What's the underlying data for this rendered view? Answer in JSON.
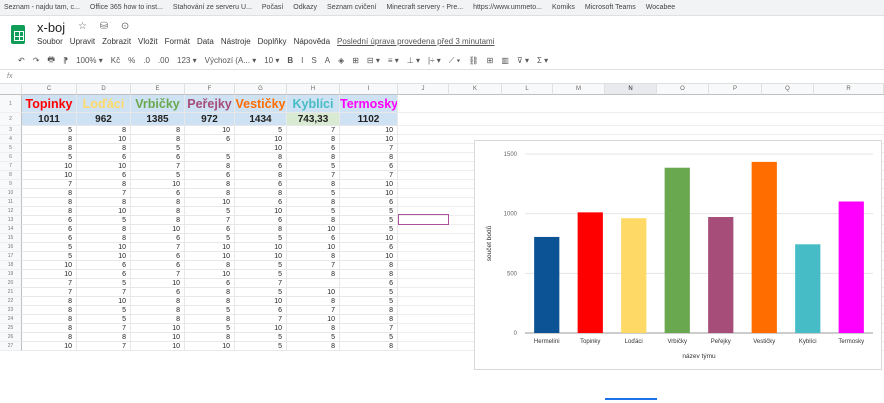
{
  "bookmarks": [
    "Seznam - najdu tam, c...",
    "Office 365 how to inst...",
    "Stahování ze serveru U...",
    "Počasí",
    "Odkazy",
    "Seznam cvičení",
    "Minecraft servery - Pre...",
    "https://www.ummeto...",
    "Komiks",
    "Microsoft Teams",
    "Wocabee"
  ],
  "doc": {
    "title": "x-boj",
    "icons": "☆ ⛁ ⊙",
    "menu": [
      "Soubor",
      "Upravit",
      "Zobrazit",
      "Vložit",
      "Formát",
      "Data",
      "Nástroje",
      "Doplňky",
      "Nápověda"
    ],
    "last_edit": "Poslední úprava provedena před 3 minutami"
  },
  "toolbar": [
    "↶",
    "↷",
    "🖶",
    "⁋",
    "100% ▾",
    "Kč",
    "%",
    ".0",
    ".00",
    "123 ▾",
    "Výchozí (A... ▾",
    "10 ▾",
    "B",
    "I",
    "S",
    "A",
    "◈",
    "⊞",
    "⊟ ▾",
    "≡ ▾",
    "⊥ ▾",
    "|÷ ▾",
    "⟋ ▾",
    "⛓",
    "⊞",
    "▥",
    "⊽ ▾",
    "Σ ▾"
  ],
  "formula_bar": "fx",
  "columns": [
    "C",
    "D",
    "E",
    "F",
    "G",
    "H",
    "I",
    "J",
    "K",
    "L",
    "M",
    "N",
    "O",
    "P",
    "Q",
    "R"
  ],
  "selected_column": "N",
  "teams": [
    {
      "name": "Topinky",
      "color": "#ff0000"
    },
    {
      "name": "Loďáci",
      "color": "#ffd966"
    },
    {
      "name": "Vrbičky",
      "color": "#6aa84f"
    },
    {
      "name": "Peřejky",
      "color": "#a64d79"
    },
    {
      "name": "Vestičky",
      "color": "#ff6d01"
    },
    {
      "name": "Kyblíci",
      "color": "#46bdc6"
    },
    {
      "name": "Termosky",
      "color": "#ff00ff"
    }
  ],
  "totals": [
    "1011",
    "962",
    "1385",
    "972",
    "1434",
    "743,33",
    "1102"
  ],
  "rows": [
    [
      "5",
      "8",
      "8",
      "10",
      "5",
      "7",
      "10"
    ],
    [
      "8",
      "10",
      "8",
      "6",
      "10",
      "8",
      "10"
    ],
    [
      "8",
      "8",
      "5",
      "",
      "10",
      "6",
      "7"
    ],
    [
      "5",
      "6",
      "6",
      "5",
      "8",
      "8",
      "8"
    ],
    [
      "10",
      "10",
      "7",
      "8",
      "6",
      "5",
      "6"
    ],
    [
      "10",
      "6",
      "5",
      "6",
      "8",
      "7",
      "7"
    ],
    [
      "7",
      "8",
      "10",
      "8",
      "6",
      "8",
      "10"
    ],
    [
      "8",
      "7",
      "6",
      "8",
      "8",
      "5",
      "10"
    ],
    [
      "8",
      "8",
      "8",
      "10",
      "6",
      "8",
      "6"
    ],
    [
      "8",
      "10",
      "8",
      "5",
      "10",
      "5",
      "5"
    ],
    [
      "6",
      "5",
      "8",
      "7",
      "6",
      "8",
      "5"
    ],
    [
      "6",
      "8",
      "10",
      "6",
      "8",
      "10",
      "5"
    ],
    [
      "6",
      "8",
      "6",
      "5",
      "5",
      "6",
      "10"
    ],
    [
      "5",
      "10",
      "7",
      "10",
      "10",
      "10",
      "6"
    ],
    [
      "5",
      "10",
      "6",
      "10",
      "10",
      "8",
      "10"
    ],
    [
      "10",
      "6",
      "6",
      "8",
      "5",
      "7",
      "8"
    ],
    [
      "10",
      "6",
      "7",
      "10",
      "5",
      "8",
      "8"
    ],
    [
      "7",
      "5",
      "10",
      "6",
      "7",
      "",
      "6"
    ],
    [
      "7",
      "7",
      "6",
      "8",
      "5",
      "10",
      "5"
    ],
    [
      "8",
      "10",
      "8",
      "8",
      "10",
      "8",
      "5"
    ],
    [
      "8",
      "5",
      "8",
      "5",
      "6",
      "7",
      "8"
    ],
    [
      "8",
      "5",
      "8",
      "8",
      "7",
      "10",
      "8"
    ],
    [
      "8",
      "7",
      "10",
      "5",
      "10",
      "8",
      "7"
    ],
    [
      "8",
      "8",
      "10",
      "8",
      "5",
      "5",
      "5"
    ],
    [
      "10",
      "7",
      "10",
      "10",
      "5",
      "8",
      "8"
    ]
  ],
  "chart_data": {
    "type": "bar",
    "categories": [
      "Hermelíni",
      "Topinky",
      "Loďáci",
      "Vrbičky",
      "Peřejky",
      "Vestičky",
      "Kyblíci",
      "Termosky"
    ],
    "values": [
      805,
      1011,
      962,
      1385,
      972,
      1434,
      743.33,
      1102
    ],
    "colors": [
      "#0b5394",
      "#ff0000",
      "#ffd966",
      "#6aa84f",
      "#a64d79",
      "#ff6d01",
      "#46bdc6",
      "#ff00ff"
    ],
    "xlabel": "název týmu",
    "ylabel": "součet bodů",
    "ylim": [
      0,
      1500
    ],
    "yticks": [
      "0",
      "500",
      "1000",
      "1500"
    ],
    "grid": true
  }
}
